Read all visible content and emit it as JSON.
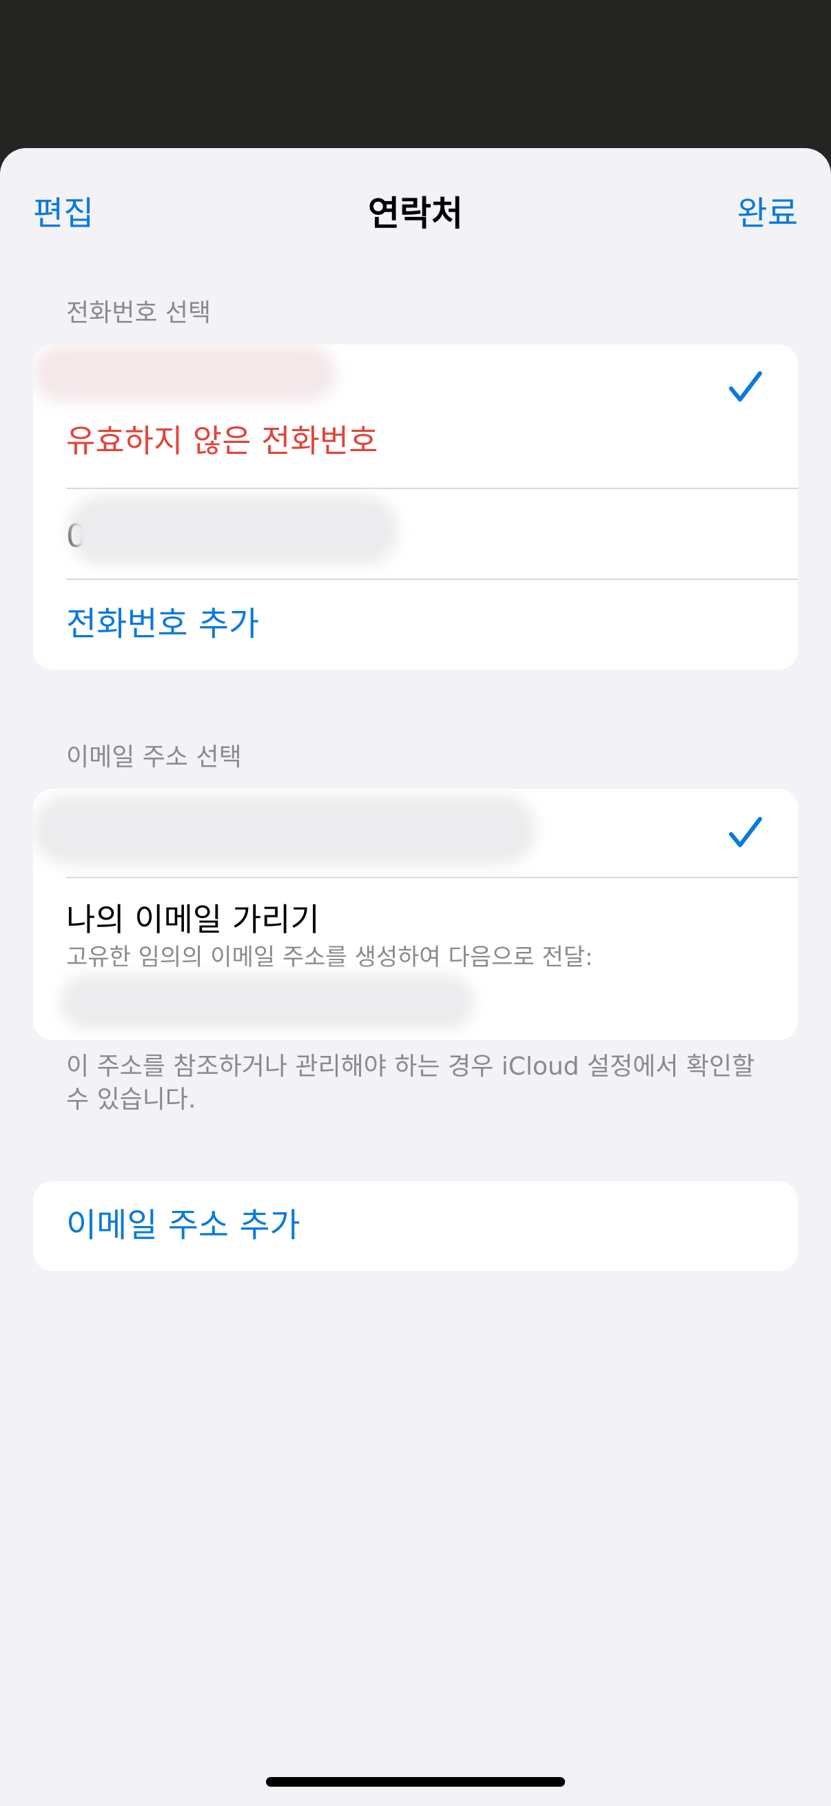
{
  "nav": {
    "edit_label": "편집",
    "title": "연락처",
    "done_label": "완료"
  },
  "phone_section": {
    "header": "전화번호 선택",
    "rows": [
      {
        "secondary": "유효하지 않은 전화번호",
        "selected": true
      },
      {
        "value": "0"
      }
    ],
    "add_label": "전화번호 추가"
  },
  "email_section": {
    "header": "이메일 주소 선택",
    "rows": [
      {
        "selected": true
      },
      {
        "title": "나의 이메일 가리기",
        "subtitle": "고유한 임의의 이메일 주소를 생성하여 다음으로 전달:"
      }
    ],
    "footer": "이 주소를 참조하거나 관리해야 하는 경우 iCloud 설정에서 확인할 수 있습니다.",
    "add_label": "이메일 주소 추가"
  },
  "colors": {
    "accent": "#0a7ad9",
    "error": "#e0453a",
    "background": "#f2f2f7",
    "dim_backdrop": "#242422"
  }
}
